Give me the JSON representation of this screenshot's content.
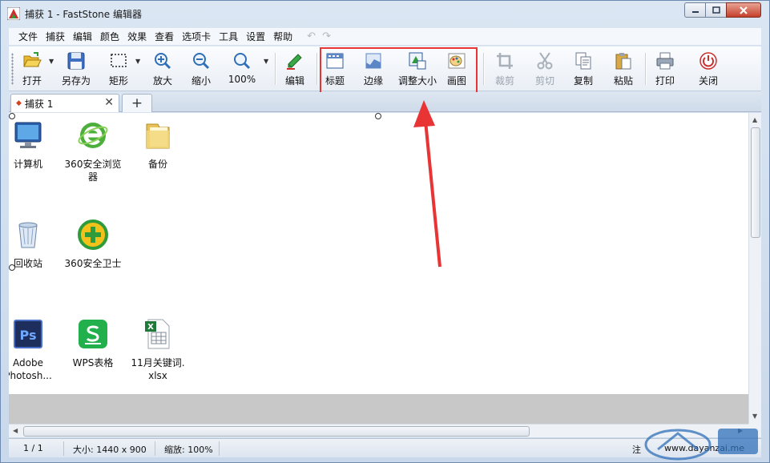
{
  "window": {
    "title": "捕获 1 - FastStone 编辑器"
  },
  "menu": [
    "文件",
    "捕获",
    "编辑",
    "颜色",
    "效果",
    "查看",
    "选项卡",
    "工具",
    "设置",
    "帮助"
  ],
  "toolbar": {
    "open": "打开",
    "save_as": "另存为",
    "rect": "矩形",
    "zoom_in": "放大",
    "zoom_out": "缩小",
    "zoom_100": "100%",
    "edit": "编辑",
    "caption": "标题",
    "edge": "边缘",
    "resize": "调整大小",
    "draw": "画图",
    "crop": "裁剪",
    "cut": "剪切",
    "copy": "复制",
    "paste": "粘贴",
    "print": "打印",
    "close": "关闭"
  },
  "tabs": [
    {
      "label": "捕获 1"
    }
  ],
  "desktop_icons": [
    {
      "label": "计算机"
    },
    {
      "label": "360安全浏览\n器"
    },
    {
      "label": "备份"
    },
    {
      "label": "回收站"
    },
    {
      "label": "360安全卫士"
    },
    {
      "label": "Adobe\nPhotosh..."
    },
    {
      "label": "WPS表格"
    },
    {
      "label": "11月关键词.\nxlsx"
    }
  ],
  "status": {
    "page": "1 / 1",
    "size": "大小: 1440 x 900",
    "zoom": "缩放: 100%",
    "register": "注",
    "url": "www.dayanzai.me"
  },
  "colors": {
    "highlight": "#e83434",
    "accent": "#2f6fb8"
  }
}
